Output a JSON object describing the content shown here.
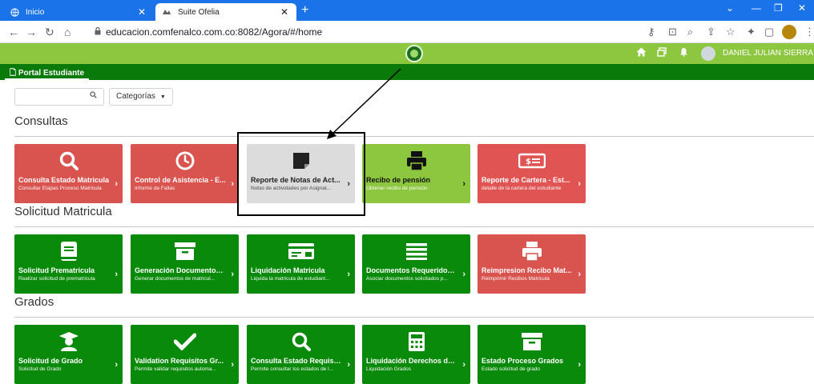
{
  "browser": {
    "tabs": [
      {
        "title": "Inicio",
        "active": false
      },
      {
        "title": "Suite Ofelia",
        "active": true
      }
    ],
    "url": "educacion.comfenalco.com.co:8082/Agora/#/home",
    "accent": "#1a73e8"
  },
  "header": {
    "user_name": "DANIEL JULIAN SIERRA AVI",
    "portal_tab": "Portal Estudiante",
    "colors": {
      "top": "#8dc63f",
      "sub": "#0a7a0a"
    }
  },
  "filters": {
    "search_placeholder": "",
    "category_label": "Categorías"
  },
  "sections": [
    {
      "title": "Consultas",
      "tiles": [
        {
          "label": "Consulta Estado Matricula",
          "desc": "Consultar Etapas Proceso Matricula",
          "icon": "search-icon",
          "color": "#d9534f"
        },
        {
          "label": "Control de Asistencia - E...",
          "desc": "Informe de Fallas",
          "icon": "clock-icon",
          "color": "#d9534f"
        },
        {
          "label": "Reporte de Notas de Act...",
          "desc": "Notas de actividades por Asignat...",
          "icon": "note-icon",
          "color": "#dcdcdc"
        },
        {
          "label": "Recibo de pensión",
          "desc": "Obtener recibo de pensión",
          "icon": "printer-icon",
          "color": "#8dc63f"
        },
        {
          "label": "Reporte de Cartera - Est...",
          "desc": "detalle de la cartera del estudiante",
          "icon": "money-icon",
          "color": "#e05454"
        }
      ]
    },
    {
      "title": "Solicitud Matricula",
      "tiles": [
        {
          "label": "Solicitud Prematricula",
          "desc": "Realizar solicitud de prematricula",
          "icon": "book-icon",
          "color": "#0a8a0a"
        },
        {
          "label": "Generación Documentos...",
          "desc": "Generar documentos de matricul...",
          "icon": "archive-icon",
          "color": "#0a8a0a"
        },
        {
          "label": "Liquidación Matricula",
          "desc": "Liquida la matricula de estudiant...",
          "icon": "card-icon",
          "color": "#0a8a0a"
        },
        {
          "label": "Documentos Requeridos...",
          "desc": "Asociar documentos solicitados p...",
          "icon": "list-icon",
          "color": "#0a8a0a"
        },
        {
          "label": "Reimpresion Recibo Mat...",
          "desc": "Reimprimir Recibos Matricula",
          "icon": "printer-icon",
          "color": "#d9534f"
        }
      ]
    },
    {
      "title": "Grados",
      "tiles": [
        {
          "label": "Solicitud de Grado",
          "desc": "Solicitud de Grado",
          "icon": "graduate-icon",
          "color": "#0a8a0a"
        },
        {
          "label": "Validation Requisitos Gr...",
          "desc": "Permite validar requisitos automa...",
          "icon": "check-icon",
          "color": "#0a8a0a"
        },
        {
          "label": "Consulta Estado Requisit...",
          "desc": "Permite consultar los estados de l...",
          "icon": "search-icon",
          "color": "#0a8a0a"
        },
        {
          "label": "Liquidación Derechos de...",
          "desc": "Liquidación Grados",
          "icon": "calculator-icon",
          "color": "#0a8a0a"
        },
        {
          "label": "Estado Proceso Grados",
          "desc": "Estado solicitud de grado",
          "icon": "archive-icon",
          "color": "#0a8a0a"
        }
      ]
    }
  ]
}
